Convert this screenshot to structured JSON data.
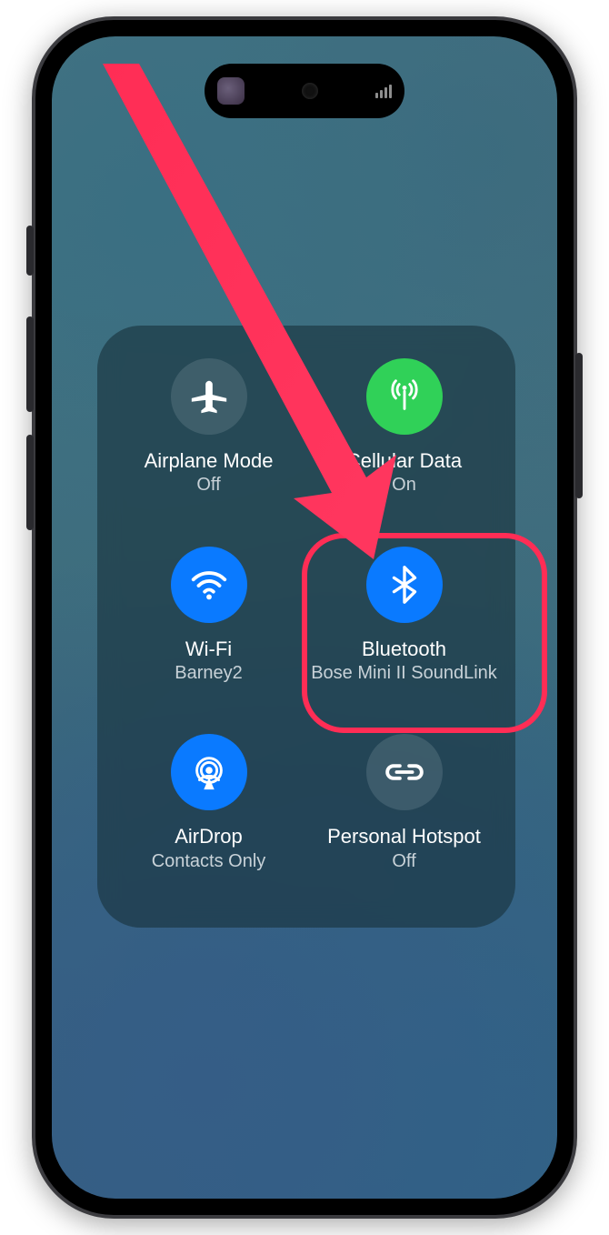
{
  "connectivity": {
    "airplane": {
      "label": "Airplane Mode",
      "status": "Off"
    },
    "cellular": {
      "label": "Cellular Data",
      "status": "On"
    },
    "wifi": {
      "label": "Wi-Fi",
      "status": "Barney2"
    },
    "bluetooth": {
      "label": "Bluetooth",
      "status": "Bose Mini II SoundLink"
    },
    "airdrop": {
      "label": "AirDrop",
      "status": "Contacts Only"
    },
    "hotspot": {
      "label": "Personal Hotspot",
      "status": "Off"
    }
  },
  "annotation": {
    "highlight_target": "bluetooth",
    "highlight_color": "#ff2d55",
    "arrow_color": "#ff2d55"
  },
  "colors": {
    "toggle_on_blue": "#0a7aff",
    "toggle_on_green": "#30d158",
    "toggle_off": "rgba(130,150,160,.28)"
  }
}
